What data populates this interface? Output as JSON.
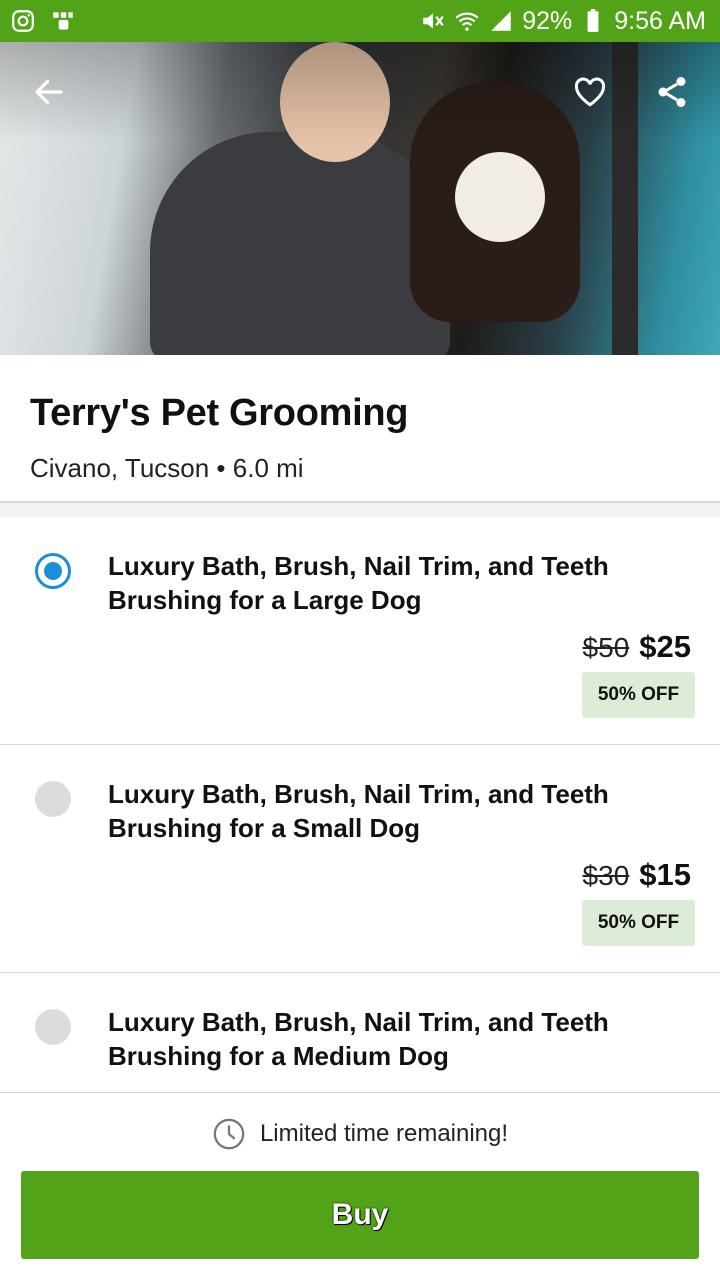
{
  "status_bar": {
    "battery": "92%",
    "time": "9:56 AM",
    "icons": [
      "instagram-icon",
      "app-icon",
      "mute-icon",
      "wifi-icon",
      "signal-icon",
      "battery-icon"
    ]
  },
  "hero": {
    "actions": [
      "back-arrow-icon",
      "heart-icon",
      "share-icon"
    ]
  },
  "merchant": {
    "name": "Terry's Pet Grooming",
    "location": "Civano, Tucson • 6.0 mi"
  },
  "options": [
    {
      "title": "Luxury Bath, Brush, Nail Trim, and Teeth Brushing for a Large Dog",
      "old_price": "$50",
      "new_price": "$25",
      "discount": "50% OFF",
      "selected": true
    },
    {
      "title": "Luxury Bath, Brush, Nail Trim, and Teeth Brushing for a Small Dog",
      "old_price": "$30",
      "new_price": "$15",
      "discount": "50% OFF",
      "selected": false
    },
    {
      "title": "Luxury Bath, Brush, Nail Trim, and Teeth Brushing for a Medium Dog",
      "selected": false
    }
  ],
  "buy_panel": {
    "timer_text": "Limited time remaining!",
    "buy_label": "Buy"
  },
  "colors": {
    "brand_green": "#53a318",
    "radio_blue": "#1b8fd6",
    "badge_bg": "#ddecd6"
  }
}
